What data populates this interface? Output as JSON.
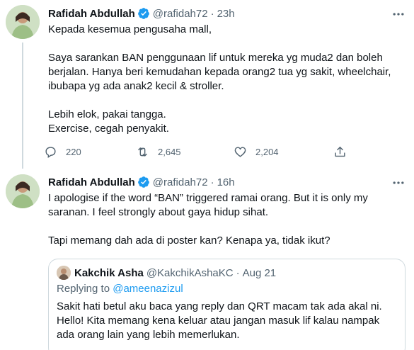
{
  "tweets": [
    {
      "author_name": "Rafidah Abdullah",
      "handle": "@rafidah72",
      "separator": "·",
      "time": "23h",
      "text_paragraphs": [
        [
          "Kepada kesemua pengusaha mall,"
        ],
        [
          "Saya sarankan BAN penggunaan lif untuk mereka yg muda2 dan boleh",
          "berjalan. Hanya beri kemudahan kepada orang2 tua yg sakit, wheelchair,",
          "ibubapa yg ada anak2 kecil & stroller."
        ],
        [
          "Lebih elok, pakai tangga.",
          "Exercise, cegah penyakit."
        ]
      ],
      "reply_count": "220",
      "retweet_count": "2,645",
      "like_count": "2,204"
    },
    {
      "author_name": "Rafidah Abdullah",
      "handle": "@rafidah72",
      "separator": "·",
      "time": "16h",
      "text_paragraphs": [
        [
          "I apologise if the word “BAN” triggered ramai orang. But it is only my",
          "saranan. I feel strongly about gaya hidup sihat."
        ],
        [
          "Tapi memang dah ada di poster kan? Kenapa ya, tidak ikut?"
        ]
      ],
      "quoted": {
        "author_name": "Kakchik Asha",
        "handle": "@KakchikAshaKC",
        "separator": "·",
        "date": "Aug 21",
        "replying_prefix": "Replying to",
        "replying_to": "@ameenazizul",
        "text_lines": [
          "Sakit hati betul aku baca yang reply dan QRT macam tak ada akal ni.",
          "Hello! Kita memang kena keluar atau jangan masuk lif kalau nampak",
          "ada orang lain yang lebih memerlukan."
        ]
      }
    }
  ],
  "icons": {
    "verified": "verified-badge-icon",
    "more": "more-horizontal-icon",
    "reply": "reply-icon",
    "retweet": "retweet-icon",
    "like": "like-icon",
    "share": "share-icon"
  },
  "colors": {
    "text": "#0f1419",
    "secondary": "#536471",
    "accent": "#1d9bf0",
    "border": "#cfd9de"
  }
}
